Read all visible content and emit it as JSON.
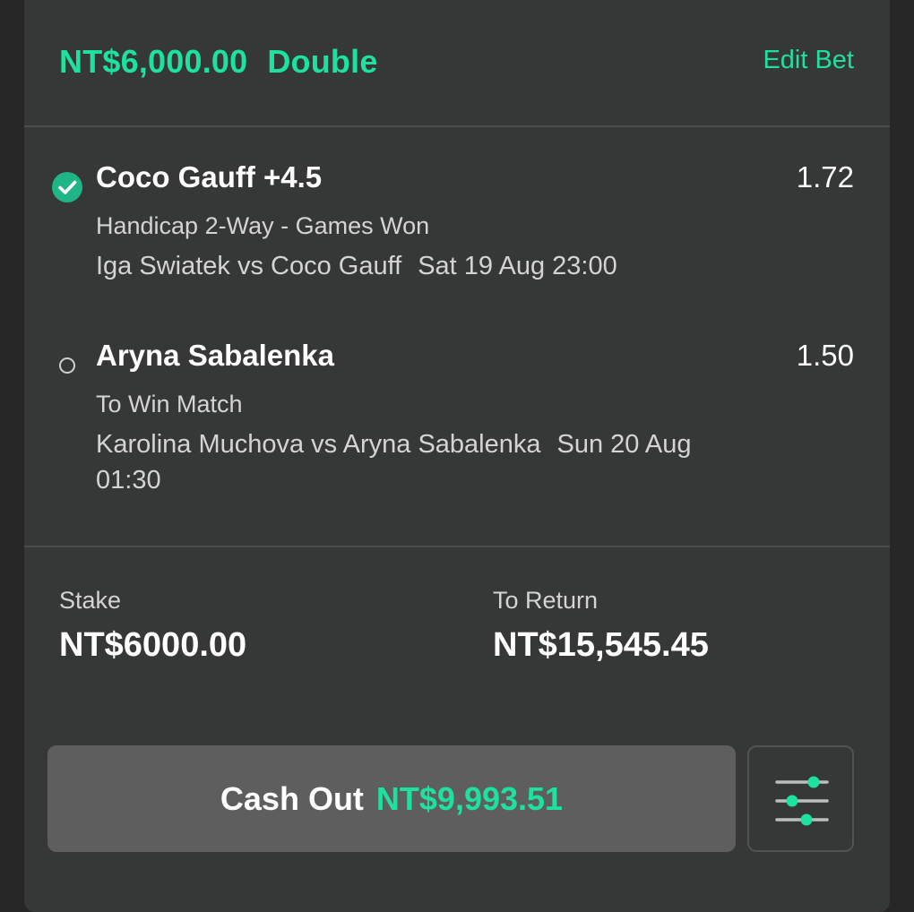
{
  "header": {
    "stake_amount": "NT$6,000.00",
    "bet_type": "Double",
    "edit_label": "Edit Bet"
  },
  "selections": [
    {
      "status": "won",
      "name": "Coco Gauff +4.5",
      "odds": "1.72",
      "market": "Handicap 2-Way - Games Won",
      "event": "Iga Swiatek vs Coco Gauff",
      "datetime": "Sat 19 Aug 23:00"
    },
    {
      "status": "pending",
      "name": "Aryna Sabalenka",
      "odds": "1.50",
      "market": "To Win Match",
      "event": "Karolina Muchova vs Aryna Sabalenka",
      "datetime": "Sun 20 Aug 01:30"
    }
  ],
  "summary": {
    "stake_label": "Stake",
    "stake_value": "NT$6000.00",
    "return_label": "To Return",
    "return_value": "NT$15,545.45"
  },
  "cashout": {
    "label": "Cash Out",
    "amount": "NT$9,993.51"
  },
  "icons": {
    "won_status": "check-circle-icon",
    "pending_status": "circle-outline-icon",
    "settings": "sliders-icon"
  },
  "colors": {
    "accent": "#1ee0a0",
    "card_bg": "#353836",
    "page_bg": "#262626",
    "button_bg": "#5e5e5e",
    "won_green": "#20b586"
  }
}
